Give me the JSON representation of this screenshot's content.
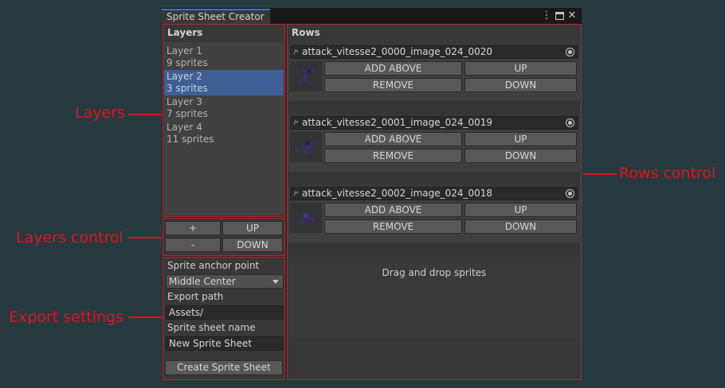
{
  "window": {
    "tab_title": "Sprite Sheet Creator",
    "menu_icon": "kebab-menu-icon",
    "maximize_icon": "maximize-icon",
    "close_icon": "close-icon"
  },
  "annotations": {
    "layers": "Layers",
    "layers_control": "Layers control",
    "export_settings": "Export settings",
    "rows_control": "Rows control",
    "color": "#e0141e"
  },
  "layers": {
    "title": "Layers",
    "items": [
      {
        "name": "Layer 1",
        "count": "9 sprites",
        "selected": false
      },
      {
        "name": "Layer 2",
        "count": "3 sprites",
        "selected": true
      },
      {
        "name": "Layer 3",
        "count": "7 sprites",
        "selected": false
      },
      {
        "name": "Layer 4",
        "count": "11 sprites",
        "selected": false
      }
    ]
  },
  "layers_control": {
    "add_label": "+",
    "remove_label": "-",
    "up_label": "UP",
    "down_label": "DOWN"
  },
  "export": {
    "anchor_label": "Sprite anchor point",
    "anchor_value": "Middle Center",
    "path_label": "Export path",
    "path_value": "Assets/",
    "name_label": "Sprite sheet name",
    "name_value": "New Sprite Sheet",
    "create_label": "Create Sprite Sheet"
  },
  "rows": {
    "title": "Rows",
    "items": [
      {
        "sprite": "attack_vitesse2_0000_image_024_0020",
        "add_above": "ADD ABOVE",
        "up": "UP",
        "remove": "REMOVE",
        "down": "DOWN"
      },
      {
        "sprite": "attack_vitesse2_0001_image_024_0019",
        "add_above": "ADD ABOVE",
        "up": "UP",
        "remove": "REMOVE",
        "down": "DOWN"
      },
      {
        "sprite": "attack_vitesse2_0002_image_024_0018",
        "add_above": "ADD ABOVE",
        "up": "UP",
        "remove": "REMOVE",
        "down": "DOWN"
      }
    ],
    "drop_hint": "Drag and drop sprites"
  }
}
